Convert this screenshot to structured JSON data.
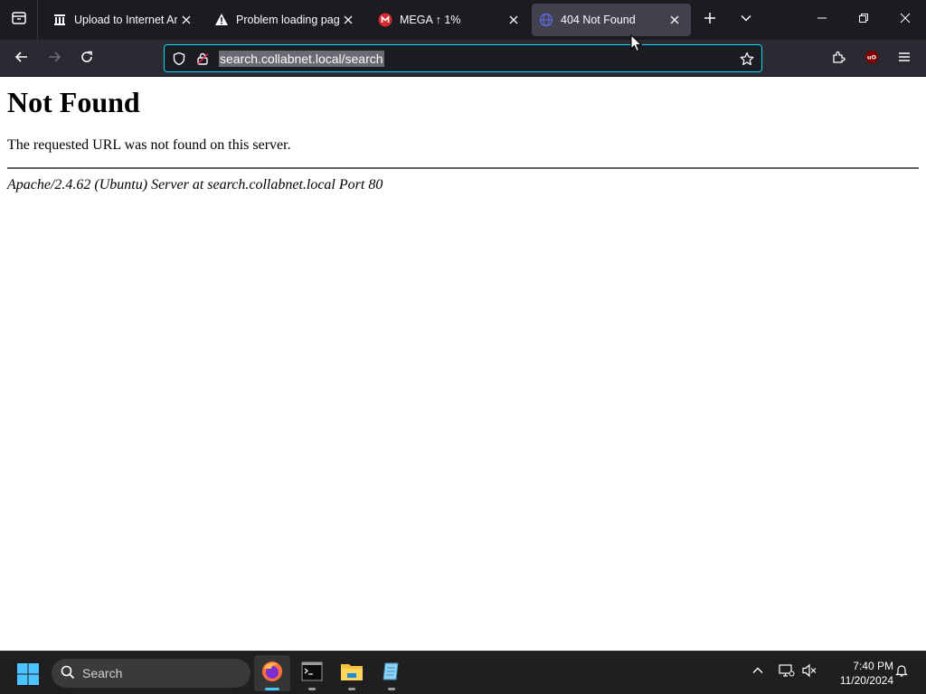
{
  "browser": {
    "tabs": [
      {
        "title": "Upload to Internet Archive",
        "icon": "archive-icon"
      },
      {
        "title": "Problem loading page",
        "icon": "warning-icon"
      },
      {
        "title": "MEGA ↑ 1%",
        "icon": "mega-icon"
      },
      {
        "title": "404 Not Found",
        "icon": "globe-icon",
        "active": true
      }
    ],
    "url": "search.collabnet.local/search",
    "colors": {
      "accent": "#00ddff",
      "tabstrip": "#1c1b22",
      "navbar": "#2b2a33"
    }
  },
  "page": {
    "heading": "Not Found",
    "message": "The requested URL was not found on this server.",
    "server_signature": "Apache/2.4.62 (Ubuntu) Server at search.collabnet.local Port 80"
  },
  "taskbar": {
    "search_label": "Search",
    "apps": [
      "firefox-icon",
      "terminal-icon",
      "file-explorer-icon",
      "notepad-icon"
    ],
    "time": "7:40 PM",
    "date": "11/20/2024"
  }
}
